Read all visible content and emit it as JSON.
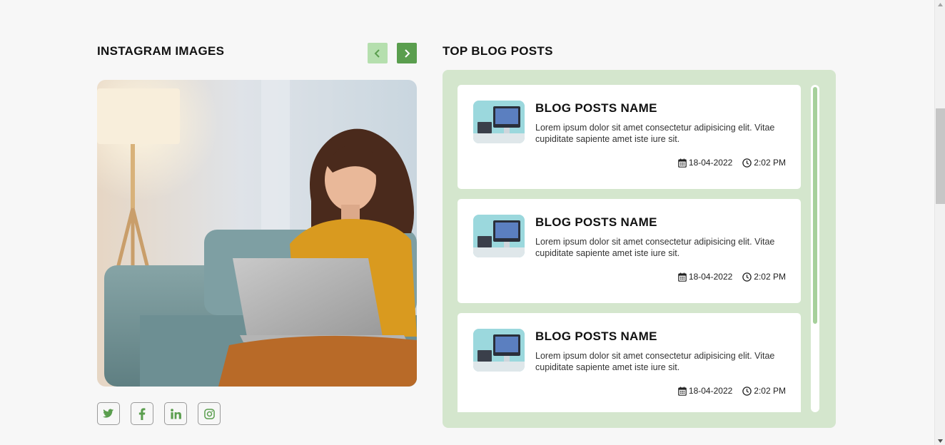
{
  "instagram": {
    "title": "INSTAGRAM IMAGES",
    "nav": {
      "prev_icon": "chevron-left-icon",
      "next_icon": "chevron-right-icon"
    },
    "social": [
      {
        "name": "twitter-icon"
      },
      {
        "name": "facebook-icon"
      },
      {
        "name": "linkedin-icon"
      },
      {
        "name": "instagram-icon"
      }
    ]
  },
  "blog": {
    "title": "TOP BLOG POSTS",
    "posts": [
      {
        "title": "BLOG POSTS NAME",
        "excerpt": "Lorem ipsum dolor sit amet consectetur adipisicing elit. Vitae cupiditate sapiente amet iste iure sit.",
        "date": "18-04-2022",
        "time": "2:02 PM"
      },
      {
        "title": "BLOG POSTS NAME",
        "excerpt": "Lorem ipsum dolor sit amet consectetur adipisicing elit. Vitae cupiditate sapiente amet iste iure sit.",
        "date": "18-04-2022",
        "time": "2:02 PM"
      },
      {
        "title": "BLOG POSTS NAME",
        "excerpt": "Lorem ipsum dolor sit amet consectetur adipisicing elit. Vitae cupiditate sapiente amet iste iure sit.",
        "date": "18-04-2022",
        "time": "2:02 PM"
      }
    ]
  },
  "colors": {
    "accent": "#5a9e4e",
    "accent_light": "#b5dfae",
    "panel_bg": "#d4e6cd",
    "page_bg": "#f7f7f7"
  }
}
